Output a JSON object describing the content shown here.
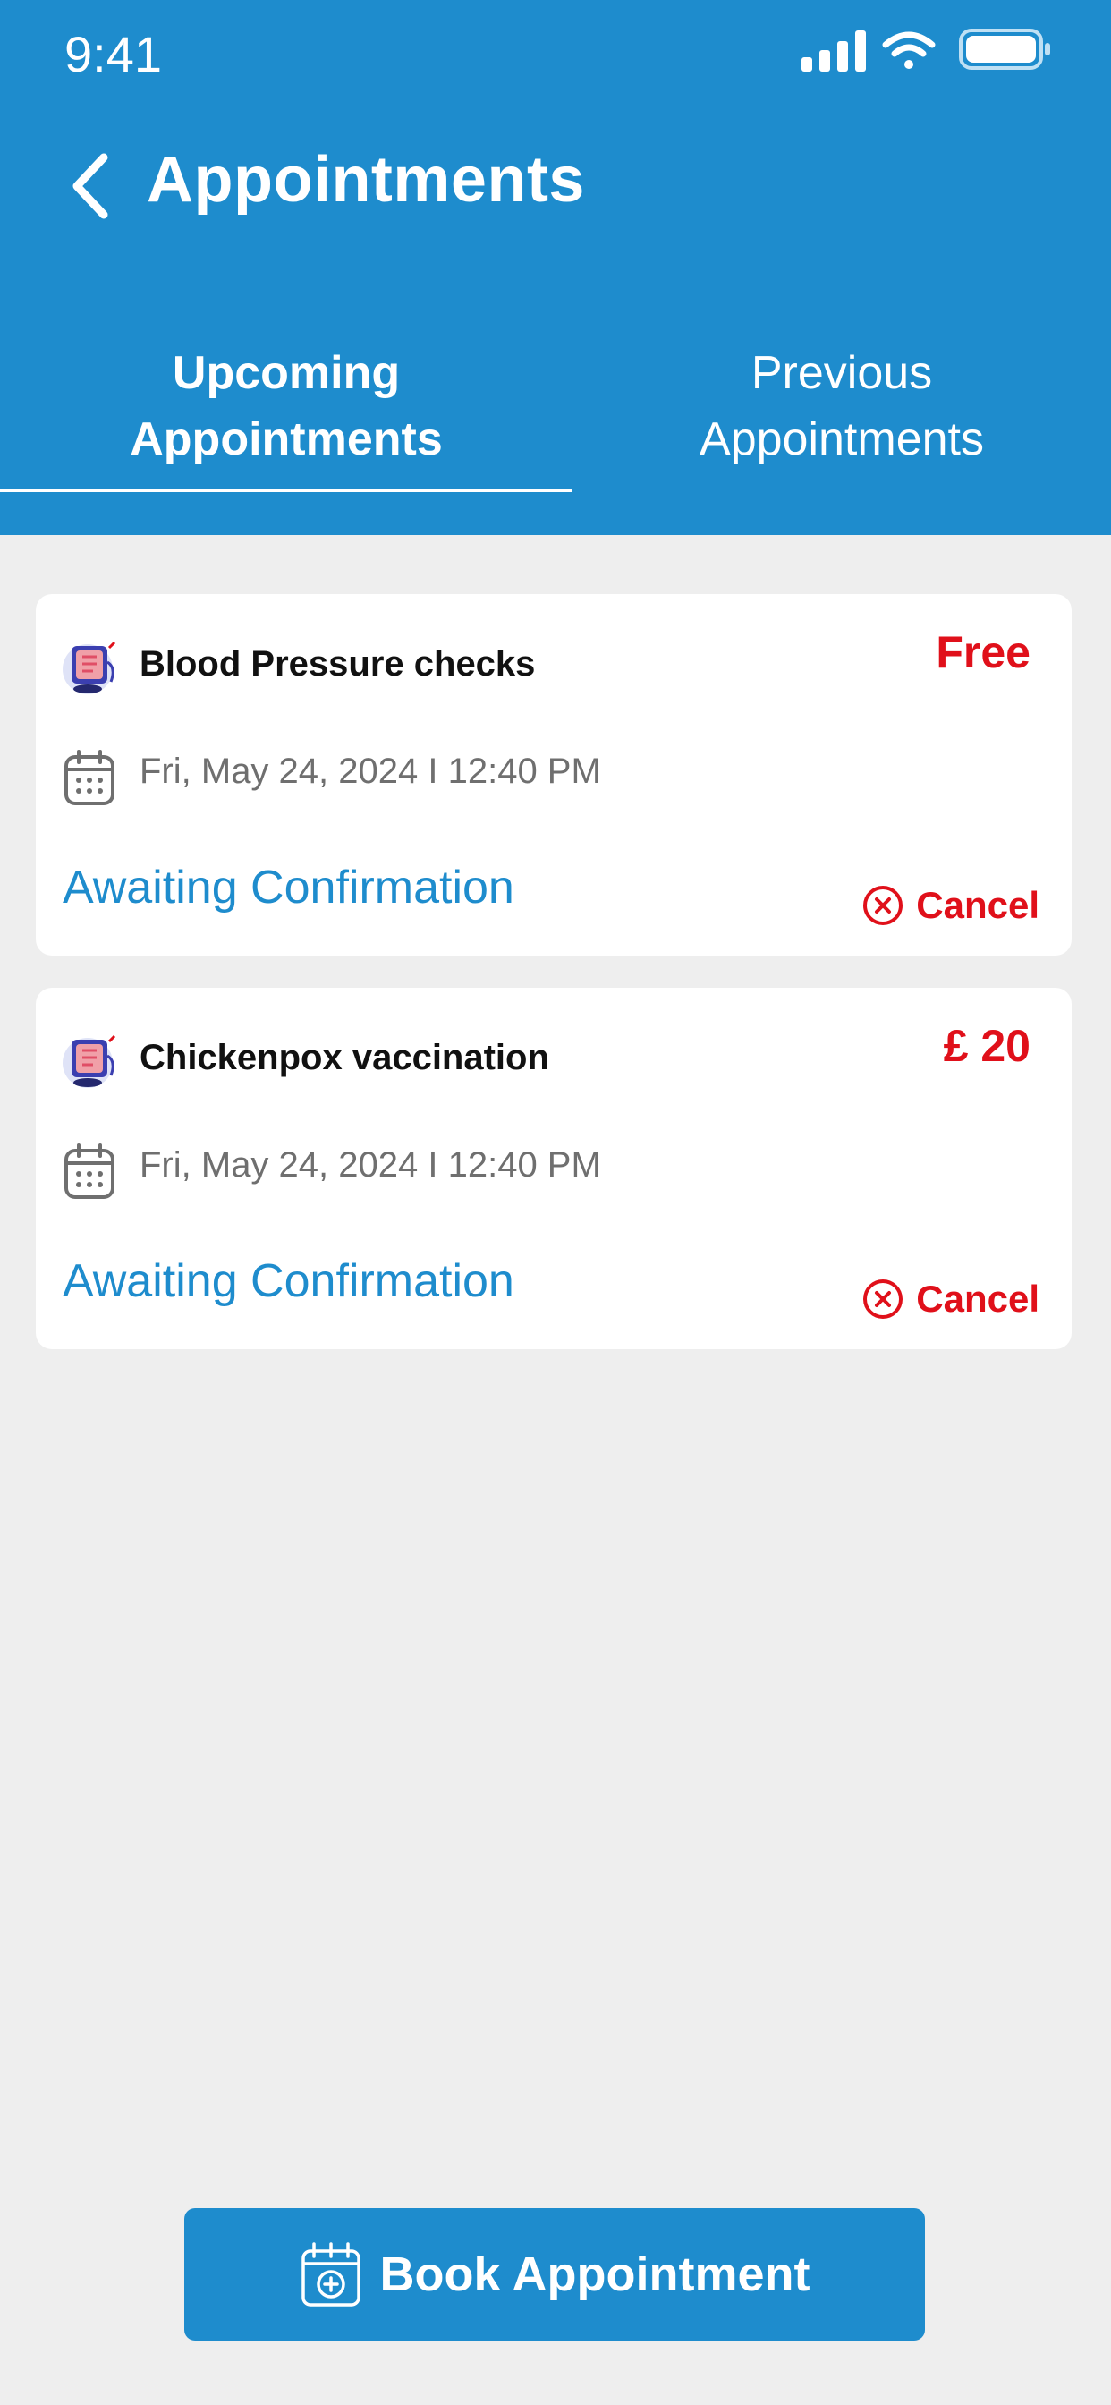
{
  "status_bar": {
    "time": "9:41"
  },
  "header": {
    "title": "Appointments"
  },
  "tabs": [
    {
      "line1": "Upcoming",
      "line2": "Appointments",
      "active": true
    },
    {
      "line1": "Previous",
      "line2": "Appointments",
      "active": false
    }
  ],
  "appointments": [
    {
      "service": "Blood Pressure checks",
      "price": "Free",
      "datetime": "Fri,  May 24, 2024 I 12:40 PM",
      "status": "Awaiting Confirmation",
      "cancel_label": "Cancel"
    },
    {
      "service": "Chickenpox vaccination",
      "price": "£ 20",
      "datetime": "Fri,  May 24, 2024 I 12:40 PM",
      "status": "Awaiting Confirmation",
      "cancel_label": "Cancel"
    }
  ],
  "book_button": {
    "label": "Book Appointment"
  },
  "colors": {
    "primary": "#1e8ccd",
    "price_red": "#e0101a",
    "background": "#eeeeee",
    "muted_text": "#6f6f6f"
  },
  "icons": {
    "back": "chevron-left-icon",
    "calendar": "calendar-icon",
    "cancel": "close-circle-icon",
    "service": "blood-pressure-monitor-icon",
    "book": "calendar-medical-icon"
  }
}
